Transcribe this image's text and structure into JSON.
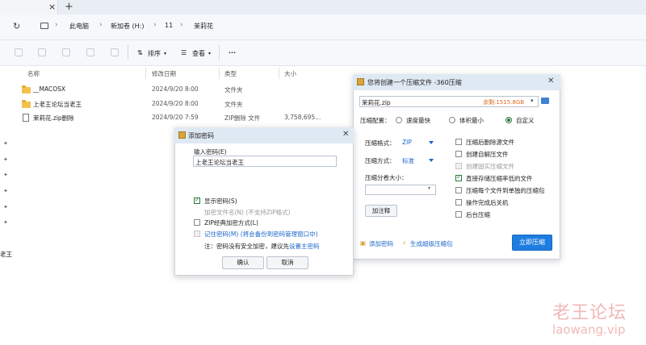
{
  "tab": {
    "close": "×",
    "add": "+"
  },
  "breadcrumb": [
    "此电脑",
    "新加卷 (H:)",
    "11",
    "茉莉花"
  ],
  "toolbar": {
    "sort": "排序",
    "view": "查看",
    "more": "···"
  },
  "columns": {
    "name": "名称",
    "date": "修改日期",
    "type": "类型",
    "size": "大小"
  },
  "files": [
    {
      "name": "__MACOSX",
      "date": "2024/9/20 8:00",
      "type": "文件夹",
      "size": ""
    },
    {
      "name": "上老王论坛当老王",
      "date": "2024/9/20 8:00",
      "type": "文件夹",
      "size": ""
    },
    {
      "name": "茉莉花.zip删除",
      "date": "2024/9/20 7:59",
      "type": "ZIP删除 文件",
      "size": "3,758,695..."
    }
  ],
  "left_edge_text": "老王",
  "compress_dialog": {
    "title": "您将创建一个压缩文件 -360压缩",
    "filename": "茉莉花.zip",
    "free_space": "余剩:1515.8GB",
    "config_label": "压缩配置：",
    "presets": [
      "速度最快",
      "体积最小",
      "自定义"
    ],
    "format_label": "压缩格式：",
    "format_value": "ZIP",
    "method_label": "压缩方式：",
    "method_value": "标准",
    "split_label": "压缩分卷大小：",
    "comment_button": "加注释",
    "options": [
      {
        "label": "压缩后删除源文件",
        "checked": false,
        "disabled": false
      },
      {
        "label": "创建自解压文件",
        "checked": false,
        "disabled": false
      },
      {
        "label": "创建固实压缩文件",
        "checked": false,
        "disabled": true
      },
      {
        "label": "直接存储压缩率低的文件",
        "checked": true,
        "disabled": false
      },
      {
        "label": "压缩每个文件到单独的压缩包",
        "checked": false,
        "disabled": false
      },
      {
        "label": "操作完成后关机",
        "checked": false,
        "disabled": false
      },
      {
        "label": "后台压缩",
        "checked": false,
        "disabled": false
      }
    ],
    "add_password_link": "添加密码",
    "super_compress_link": "生成超级压缩包",
    "start_button": "立即压缩"
  },
  "password_dialog": {
    "title": "添加密码",
    "input_label": "输入密码(E)",
    "password_value": "上老王论坛当老王",
    "show_password": "显示密码(S)",
    "encrypt_filenames": "加密文件名(N) (不支持ZIP格式)",
    "zip_classic": "ZIP经典加密方式(L)",
    "remember_password": "记住密码(M) (将会备份到密码管理窗口中)",
    "note_prefix": "注：密码没有安全加密，建议先",
    "note_link": "设置主密码",
    "ok_button": "确认",
    "cancel_button": "取消"
  },
  "watermark": {
    "cn": "老王论坛",
    "en": "laowang.vip"
  }
}
